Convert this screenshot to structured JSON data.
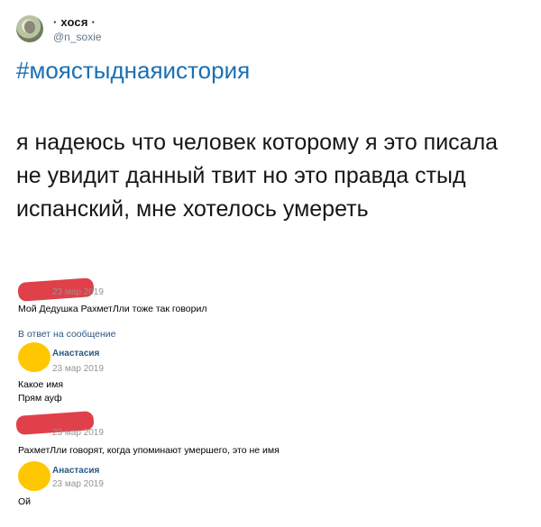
{
  "author": {
    "display_name": "· хося ·",
    "handle": "@n_soxie"
  },
  "tweet": {
    "hashtag": "#моястыднаяистория",
    "text": "я надеюсь что человек которому я это писала не увидит данный твит но это правда стыд испанский, мне хотелось умереть"
  },
  "vk_thread": {
    "comments": [
      {
        "date": "23 мар 2019",
        "text": "Мой Дедушка РахметЛли тоже так говорил"
      },
      {
        "reply_link": "В ответ на сообщение"
      },
      {
        "name": "Анастасия",
        "date": "23 мар 2019",
        "lines": [
          "Какое имя",
          "Прям ауф"
        ]
      },
      {
        "date": "23 мар 2019",
        "text": "РахметЛли говорят, когда упоминают умершего, это не имя"
      },
      {
        "name": "Анастасия",
        "date": "23 мар 2019",
        "text": "Ой"
      }
    ]
  },
  "colors": {
    "hashtag": "#1b6fb3",
    "vk_link": "#2a5885",
    "redaction_red": "#e0404a",
    "redaction_yellow": "#ffc700"
  }
}
